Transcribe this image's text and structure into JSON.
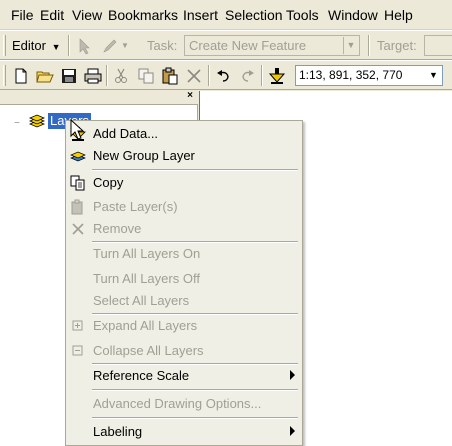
{
  "menubar": {
    "items": [
      {
        "label": "File",
        "u": "F"
      },
      {
        "label": "Edit",
        "u": "E"
      },
      {
        "label": "View",
        "u": "V"
      },
      {
        "label": "Bookmarks",
        "u": "B"
      },
      {
        "label": "Insert",
        "u": "I"
      },
      {
        "label": "Selection",
        "u": "S"
      },
      {
        "label": "Tools",
        "u": "T"
      },
      {
        "label": "Window",
        "u": "W"
      },
      {
        "label": "Help",
        "u": "H"
      }
    ]
  },
  "editor_toolbar": {
    "editor_label": "Editor",
    "task_label": "Task:",
    "task_value": "Create New Feature",
    "target_label": "Target:"
  },
  "standard_toolbar": {
    "scale_value": "1:13, 891, 352, 770"
  },
  "toc": {
    "layers_label": "Layers"
  },
  "context_menu": {
    "add_data": "Add Data...",
    "new_group_layer": "New Group Layer",
    "copy": "Copy",
    "paste_layers": "Paste Layer(s)",
    "remove": "Remove",
    "turn_all_layers_on": "Turn All Layers On",
    "turn_all_layers_off": "Turn All Layers Off",
    "select_all_layers": "Select All Layers",
    "expand_all_layers": "Expand All Layers",
    "collapse_all_layers": "Collapse All Layers",
    "reference_scale": "Reference Scale",
    "advanced_drawing_options": "Advanced Drawing Options...",
    "labeling": "Labeling"
  },
  "colors": {
    "selection": "#316ac5",
    "disabled_text": "#a09f94",
    "chrome": "#ece9d8"
  }
}
